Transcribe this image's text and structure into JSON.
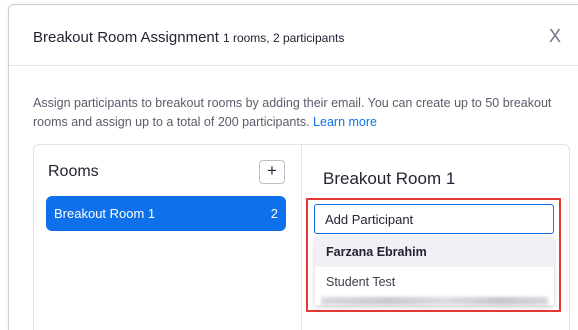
{
  "dialog": {
    "title": "Breakout Room Assignment",
    "subtitle": "1 rooms, 2 participants",
    "close_glyph": "X"
  },
  "description": {
    "text": "Assign participants to breakout rooms by adding their email. You can create up to 50 breakout rooms and assign up to a total of 200 participants.",
    "link": "Learn more"
  },
  "rooms": {
    "heading": "Rooms",
    "add_label": "+",
    "items": [
      {
        "label": "Breakout Room 1",
        "count": "2"
      }
    ]
  },
  "room_detail": {
    "title": "Breakout Room 1",
    "input_placeholder": "Add Participant",
    "suggestions": [
      {
        "name": "Farzana Ebrahim"
      },
      {
        "name": "Student Test"
      }
    ]
  },
  "colors": {
    "accent": "#0e71eb",
    "highlight": "#e53935"
  }
}
